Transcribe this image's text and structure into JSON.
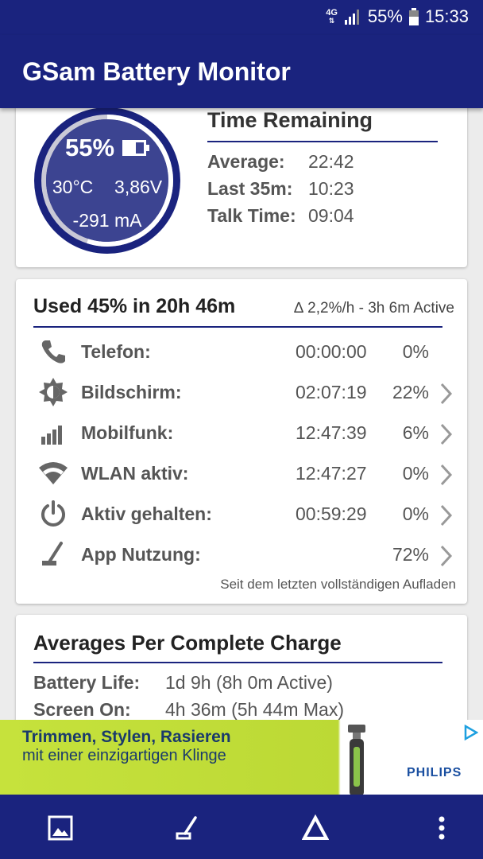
{
  "status_bar": {
    "network": "4G",
    "battery": "55%",
    "time": "15:33"
  },
  "app": {
    "title": "GSam Battery Monitor"
  },
  "gauge": {
    "percent": "55%",
    "temp": "30°C",
    "voltage": "3,86V",
    "current": "-291 mA",
    "level": 0.55,
    "ring_color": "#1a237e"
  },
  "time_remaining": {
    "title": "Time Remaining",
    "rows": [
      {
        "label": "Average:",
        "value": "22:42"
      },
      {
        "label": "Last 35m:",
        "value": "10:23"
      },
      {
        "label": "Talk Time:",
        "value": "09:04"
      }
    ]
  },
  "usage": {
    "title": "Used 45% in 20h 46m",
    "subtitle": "∆ 2,2%/h - 3h 6m Active",
    "rows": [
      {
        "icon": "phone-icon",
        "label": "Telefon:",
        "time": "00:00:00",
        "pct": "0%"
      },
      {
        "icon": "brightness-icon",
        "label": "Bildschirm:",
        "time": "02:07:19",
        "pct": "22%"
      },
      {
        "icon": "signal-bars-icon",
        "label": "Mobilfunk:",
        "time": "12:47:39",
        "pct": "6%"
      },
      {
        "icon": "wifi-icon",
        "label": "WLAN aktiv:",
        "time": "12:47:27",
        "pct": "0%"
      },
      {
        "icon": "power-icon",
        "label": "Aktiv gehalten:",
        "time": "00:59:29",
        "pct": "0%"
      },
      {
        "icon": "app-usage-icon",
        "label": "App Nutzung:",
        "time": "",
        "pct": "72%"
      }
    ],
    "since": "Seit dem letzten vollständigen Aufladen"
  },
  "averages": {
    "title": "Averages Per Complete Charge",
    "rows": [
      {
        "label": "Battery Life:",
        "value": "1d 9h (8h 0m Active)"
      },
      {
        "label": "Screen On:",
        "value": "4h 36m (5h 44m Max)"
      }
    ]
  },
  "ad": {
    "line1": "Trimmen, Stylen, Rasieren",
    "line2": "mit einer einzigartigen Klinge",
    "brand": "PHILIPS",
    "bg_color": "#c6e23c"
  },
  "nav": {
    "items": [
      "image-icon",
      "app-usage-icon",
      "delta-icon",
      "overflow-menu-icon"
    ]
  }
}
